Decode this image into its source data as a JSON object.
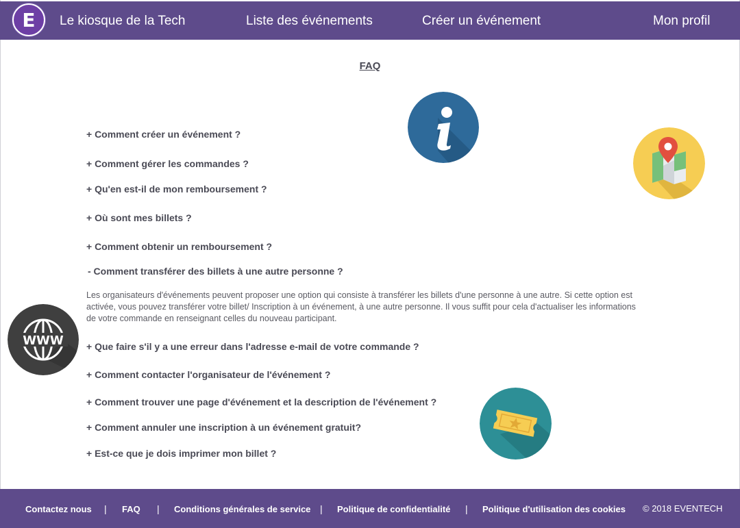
{
  "header": {
    "logo_letter": "E",
    "brand": "Le kiosque de la Tech",
    "nav": [
      "Liste des événements",
      "Créer un événement",
      "Mon profil"
    ]
  },
  "faq": {
    "title": "FAQ",
    "questions": [
      "+ Comment créer un événement ?",
      "+ Comment gérer les commandes ?",
      "+ Qu'en est-il de mon remboursement ?",
      "+ Où sont mes billets ?",
      "+ Comment obtenir un remboursement ?",
      "- Comment transférer des billets à une autre personne ?",
      "+ Que faire s'il y a une erreur dans l'adresse e-mail de votre commande ?",
      "+ Comment contacter l'organisateur de l'événement ?",
      "+ Comment trouver une page d'événement et la description de l'événement ?",
      "+ Comment annuler une inscription à un événement gratuit?",
      "+ Est-ce que je dois imprimer mon billet ?"
    ],
    "answer": "Les organisateurs d'événements peuvent proposer une option qui consiste à transférer les billets d'une personne à une autre. Si cette option est activée, vous pouvez transférer votre billet/ Inscription à un événement, à une autre personne. Il vous suffit pour cela d'actualiser les informations de votre commande en renseignant celles du nouveau participant."
  },
  "icons": {
    "info": "info-icon",
    "map": "map-pin-icon",
    "www": "www-globe-icon",
    "ticket": "ticket-icon"
  },
  "footer": {
    "links": [
      "Contactez nous",
      "FAQ",
      "Conditions générales de service",
      "Politique de confidentialité",
      "Politique d'utilisation des cookies"
    ],
    "separator": "|",
    "copyright": "© 2018 EVENTECH"
  },
  "colors": {
    "header_bg": "#5e4b8b",
    "info_blue": "#2e6a9a",
    "map_yellow": "#f6cd53",
    "www_dark": "#3f3f3f",
    "ticket_teal": "#2d8f96"
  }
}
